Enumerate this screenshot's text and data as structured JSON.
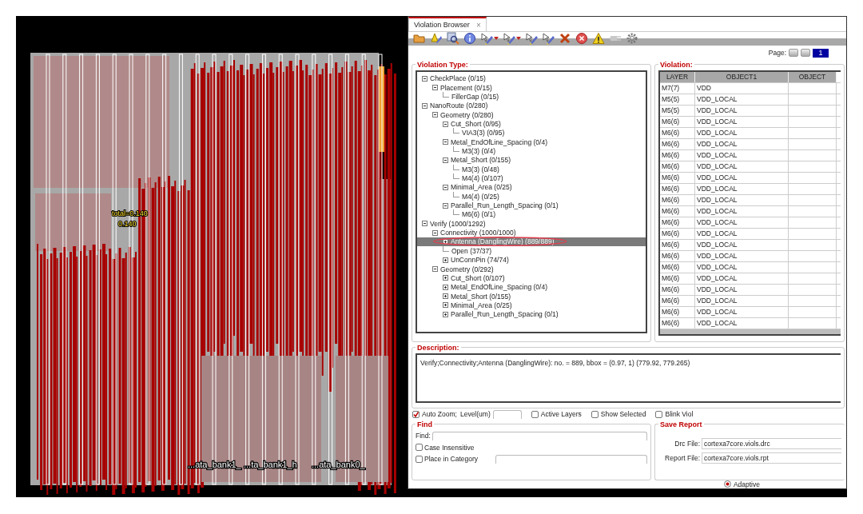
{
  "layout_view": {
    "labels": [
      {
        "text": "total=0.140"
      },
      {
        "text": "0.140"
      },
      {
        "text": "...ata_bank1_"
      },
      {
        "text": "...ta_bank1_h"
      },
      {
        "text": "...ata_bank0_"
      }
    ]
  },
  "tab": {
    "label": "Violation Browser",
    "close": "×",
    "selected": true
  },
  "page": {
    "label": "Page:",
    "value": "1"
  },
  "violation_type": {
    "title": "Violation Type:",
    "tree": [
      {
        "label": "CheckPlace (0/15)",
        "expanded": true,
        "selected": false,
        "children": [
          {
            "label": "Placement (0/15)",
            "expanded": true,
            "selected": false,
            "children": [
              {
                "label": "FillerGap (0/15)",
                "selected": false
              }
            ]
          }
        ]
      },
      {
        "label": "NanoRoute (0/280)",
        "expanded": true,
        "selected": false,
        "children": [
          {
            "label": "Geometry (0/280)",
            "expanded": true,
            "selected": false,
            "children": [
              {
                "label": "Cut_Short (0/95)",
                "expanded": true,
                "selected": false,
                "children": [
                  {
                    "label": "VIA3(3) (0/95)",
                    "selected": false
                  }
                ]
              },
              {
                "label": "Metal_EndOfLine_Spacing (0/4)",
                "expanded": true,
                "selected": false,
                "children": [
                  {
                    "label": "M3(3) (0/4)",
                    "selected": false
                  }
                ]
              },
              {
                "label": "Metal_Short (0/155)",
                "expanded": true,
                "selected": false,
                "children": [
                  {
                    "label": "M3(3) (0/48)",
                    "selected": false
                  },
                  {
                    "label": "M4(4) (0/107)",
                    "selected": false
                  }
                ]
              },
              {
                "label": "Minimal_Area (0/25)",
                "expanded": true,
                "selected": false,
                "children": [
                  {
                    "label": "M4(4) (0/25)",
                    "selected": false
                  }
                ]
              },
              {
                "label": "Parallel_Run_Length_Spacing (0/1)",
                "expanded": true,
                "selected": false,
                "children": [
                  {
                    "label": "M6(6) (0/1)",
                    "selected": false
                  }
                ]
              }
            ]
          }
        ]
      },
      {
        "label": "Verify (1000/1292)",
        "expanded": true,
        "selected": false,
        "children": [
          {
            "label": "Connectivity (1000/1000)",
            "expanded": true,
            "selected": false,
            "children": [
              {
                "label": "Antenna (DanglingWire) (889/889)",
                "expanded": false,
                "selected": true
              },
              {
                "label": "Open (37/37)",
                "selected": false
              },
              {
                "label": "UnConnPin (74/74)",
                "expanded": false,
                "selected": false
              }
            ]
          },
          {
            "label": "Geometry (0/292)",
            "expanded": true,
            "selected": false,
            "children": [
              {
                "label": "Cut_Short (0/107)",
                "expanded": false,
                "selected": false
              },
              {
                "label": "Metal_EndOfLine_Spacing (0/4)",
                "expanded": false,
                "selected": false
              },
              {
                "label": "Metal_Short (0/155)",
                "expanded": false,
                "selected": false
              },
              {
                "label": "Minimal_Area (0/25)",
                "expanded": false,
                "selected": false
              },
              {
                "label": "Parallel_Run_Length_Spacing (0/1)",
                "expanded": false,
                "selected": false
              }
            ]
          }
        ]
      }
    ]
  },
  "violation": {
    "title": "Violation:",
    "columns": [
      "LAYER",
      "OBJECT1",
      "OBJECT"
    ],
    "rows": [
      [
        "M7(7)",
        "VDD"
      ],
      [
        "M5(5)",
        "VDD_LOCAL"
      ],
      [
        "M5(5)",
        "VDD_LOCAL"
      ],
      [
        "M6(6)",
        "VDD_LOCAL"
      ],
      [
        "M6(6)",
        "VDD_LOCAL"
      ],
      [
        "M6(6)",
        "VDD_LOCAL"
      ],
      [
        "M6(6)",
        "VDD_LOCAL"
      ],
      [
        "M6(6)",
        "VDD_LOCAL"
      ],
      [
        "M6(6)",
        "VDD_LOCAL"
      ],
      [
        "M6(6)",
        "VDD_LOCAL"
      ],
      [
        "M6(6)",
        "VDD_LOCAL"
      ],
      [
        "M6(6)",
        "VDD_LOCAL"
      ],
      [
        "M6(6)",
        "VDD_LOCAL"
      ],
      [
        "M6(6)",
        "VDD_LOCAL"
      ],
      [
        "M6(6)",
        "VDD_LOCAL"
      ],
      [
        "M6(6)",
        "VDD_LOCAL"
      ],
      [
        "M6(6)",
        "VDD_LOCAL"
      ],
      [
        "M6(6)",
        "VDD_LOCAL"
      ],
      [
        "M6(6)",
        "VDD_LOCAL"
      ],
      [
        "M6(6)",
        "VDD_LOCAL"
      ],
      [
        "M6(6)",
        "VDD_LOCAL"
      ],
      [
        "M6(6)",
        "VDD_LOCAL"
      ]
    ]
  },
  "description": {
    "title": "Description:",
    "text": "Verify;Connectivity;Antenna (DanglingWire): no. = 889, bbox = (0.97, 1) (779.92, 779.265)"
  },
  "options": [
    {
      "kind": "checkbox",
      "label": "Auto Zoom;",
      "checked": true
    },
    {
      "kind": "field",
      "label": "Level(um)"
    },
    {
      "kind": "checkbox",
      "label": "Active Layers",
      "checked": false
    },
    {
      "kind": "checkbox",
      "label": "Show Selected",
      "checked": false
    },
    {
      "kind": "checkbox",
      "label": "Blink Viol",
      "checked": false
    }
  ],
  "find": {
    "title": "Find",
    "field_label": "Find:",
    "checks": [
      {
        "kind": "checkbox",
        "label": "Case Insensitive",
        "checked": false
      },
      {
        "kind": "checkbox_field",
        "label": "Place in Category",
        "checked": false
      }
    ]
  },
  "save_report": {
    "title": "Save Report",
    "fields": [
      {
        "label": "Drc File:",
        "value": "cortexa7core.viols.drc"
      },
      {
        "label": "Report File:",
        "value": "cortexa7core.viols.rpt"
      }
    ]
  },
  "adaptive": {
    "label": "Adaptive",
    "selected": true
  }
}
